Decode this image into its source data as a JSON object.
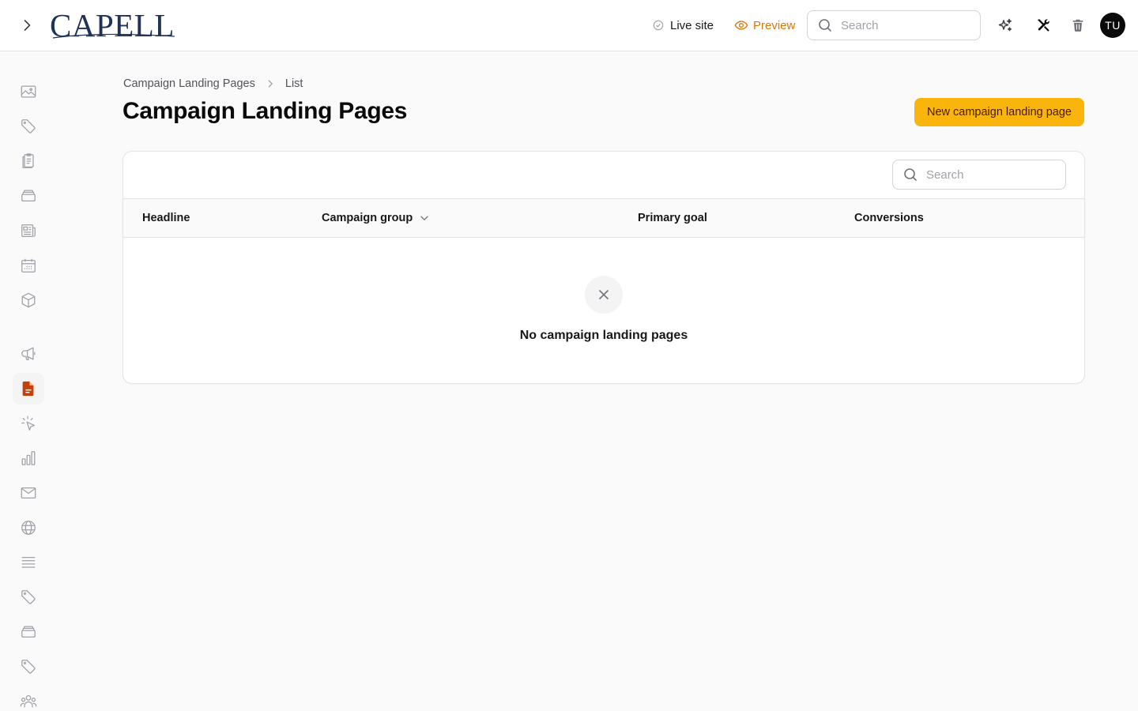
{
  "header": {
    "logo_text": "CAPELL",
    "live_site_label": "Live site",
    "preview_label": "Preview",
    "search_placeholder": "Search",
    "avatar_initials": "TU"
  },
  "sidebar": {
    "items": [
      {
        "icon": "image-icon",
        "active": false
      },
      {
        "icon": "tag-icon",
        "active": false
      },
      {
        "icon": "clipboard-icon",
        "active": false
      },
      {
        "icon": "stack-icon",
        "active": false
      },
      {
        "icon": "newspaper-icon",
        "active": false
      },
      {
        "icon": "calendar-icon",
        "active": false
      },
      {
        "icon": "cube-icon",
        "active": false
      },
      {
        "icon": "megaphone-icon",
        "active": false
      },
      {
        "icon": "document-icon",
        "active": true
      },
      {
        "icon": "cursor-click-icon",
        "active": false
      },
      {
        "icon": "bar-chart-icon",
        "active": false
      },
      {
        "icon": "envelope-icon",
        "active": false
      },
      {
        "icon": "globe-icon",
        "active": false
      },
      {
        "icon": "list-icon",
        "active": false
      },
      {
        "icon": "tag-icon",
        "active": false
      },
      {
        "icon": "stack-icon",
        "active": false
      },
      {
        "icon": "tag-icon",
        "active": false
      },
      {
        "icon": "users-icon",
        "active": false
      }
    ]
  },
  "breadcrumb": {
    "parent": "Campaign Landing Pages",
    "current": "List"
  },
  "page": {
    "title": "Campaign Landing Pages",
    "new_button_label": "New campaign landing page"
  },
  "table": {
    "search_placeholder": "Search",
    "columns": [
      "Headline",
      "Campaign group",
      "Primary goal",
      "Conversions"
    ],
    "rows": [],
    "empty_message": "No campaign landing pages"
  },
  "colors": {
    "accent": "#f9b50b",
    "preview": "#d97706",
    "active_icon": "#c2410c"
  }
}
